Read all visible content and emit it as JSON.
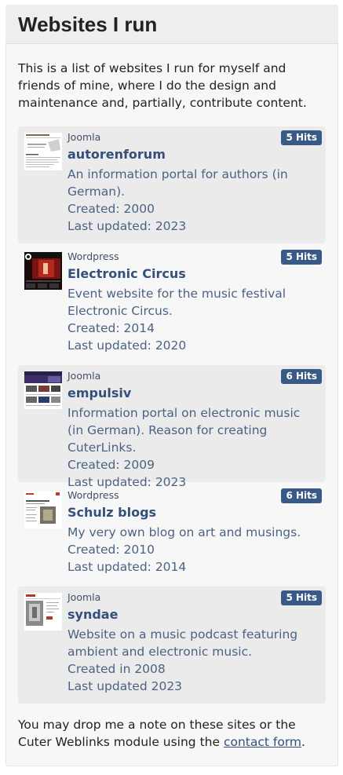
{
  "module": {
    "title": "Websites I run",
    "intro": "This is a list of websites I run for myself and friends of mine, where I do the design and maintenance and, partially, contribute content."
  },
  "links": [
    {
      "category": "Joomla",
      "hits": "5 Hits",
      "name": "autorenforum",
      "description": "An information portal for authors (in German).",
      "created": "Created: 2000",
      "updated": "Last updated: 2023",
      "thumbnail": "autorenforum-screenshot"
    },
    {
      "category": "Wordpress",
      "hits": "5 Hits",
      "name": "Electronic Circus",
      "description": "Event website for the music festival Electronic Circus.",
      "created": "Created: 2014",
      "updated": "Last updated: 2020",
      "thumbnail": "electronic-circus-screenshot"
    },
    {
      "category": "Joomla",
      "hits": "6 Hits",
      "name": "empulsiv",
      "description": "Information portal on electronic music (in German). Reason for creating CuterLinks.",
      "created": "Created: 2009",
      "updated": "Last updated: 2023",
      "thumbnail": "empulsiv-screenshot"
    },
    {
      "category": "Wordpress",
      "hits": "6 Hits",
      "name": "Schulz blogs",
      "description": "My very own blog on art and musings.",
      "created": "Created: 2010",
      "updated": "Last updated: 2014",
      "thumbnail": "schulz-blogs-screenshot"
    },
    {
      "category": "Joomla",
      "hits": "5 Hits",
      "name": "syndae",
      "description": "Website on a music podcast featuring ambient and electronic music.",
      "created": "Created in 2008",
      "updated": "Last updated 2023",
      "thumbnail": "syndae-screenshot"
    }
  ],
  "footer": {
    "text_before": "You may drop me a note on these sites or the Cuter Weblinks module using the ",
    "link_label": "contact form",
    "text_after": "."
  },
  "colors": {
    "badge": "#3a5a86",
    "link": "#34507a",
    "description": "#4b6282",
    "item_shade": "#ebebeb"
  }
}
